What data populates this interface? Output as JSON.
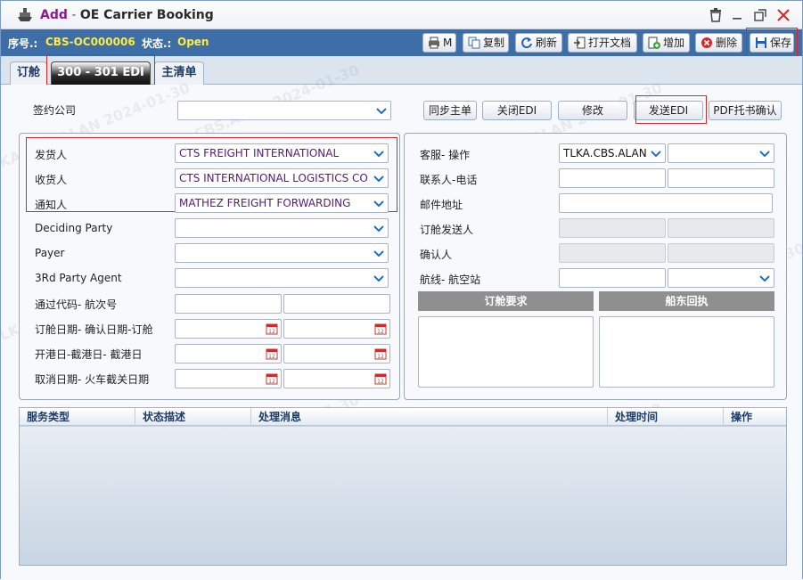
{
  "window": {
    "title_add": "Add",
    "title_sep": " - ",
    "title_main": "OE Carrier Booking"
  },
  "status": {
    "seq_label": "序号.:",
    "seq_value": "CBS-OC000006",
    "state_label": "状态.:",
    "state_value": "Open"
  },
  "toolbar": {
    "print_label": "M",
    "copy_label": "复制",
    "refresh_label": "刷新",
    "open_doc_label": "打开文档",
    "add_label": "增加",
    "delete_label": "删除",
    "save_label": "保存"
  },
  "tabs": [
    {
      "label": "订舱"
    },
    {
      "label": "300 - 301 EDI"
    },
    {
      "label": "主清单"
    }
  ],
  "top": {
    "contract_company_label": "签约公司",
    "contract_company_value": "",
    "sync_master_label": "同步主单",
    "close_edi_label": "关闭EDI",
    "modify_label": "修改",
    "send_edi_label": "发送EDI",
    "pdf_confirm_label": "PDF托书确认"
  },
  "left": {
    "shipper_label": "发货人",
    "shipper_value": "CTS FREIGHT INTERNATIONAL",
    "consignee_label": "收货人",
    "consignee_value": "CTS INTERNATIONAL LOGISTICS CO",
    "notify_label": "通知人",
    "notify_value": "MATHEZ FREIGHT FORWARDING",
    "deciding_party_label": "Deciding Party",
    "payer_label": "Payer",
    "third_party_label": "3Rd Party Agent",
    "pass_code_label": "通过代码- 航次号",
    "booking_date_label": "订舱日期- 确认日期-订舱",
    "sailing_date_label": "开港日-截港日- 截港日",
    "cancel_date_label": "取消日期- 火车截关日期"
  },
  "right": {
    "cs_op_label": "客服- 操作",
    "cs_op_value": "TLKA.CBS.ALAN",
    "contact_label": "联系人-电话",
    "email_label": "邮件地址",
    "booking_sender_label": "订舱发送人",
    "confirmer_label": "确认人",
    "route_label": "航线- 航空站",
    "booking_req_label": "订舱要求",
    "carrier_reply_label": "船东回执"
  },
  "grid": {
    "columns": [
      "服务类型",
      "状态描述",
      "处理消息",
      "处理时间",
      "操作"
    ]
  },
  "watermark": "TLKA.CBS.ALAN 2024-01-30"
}
